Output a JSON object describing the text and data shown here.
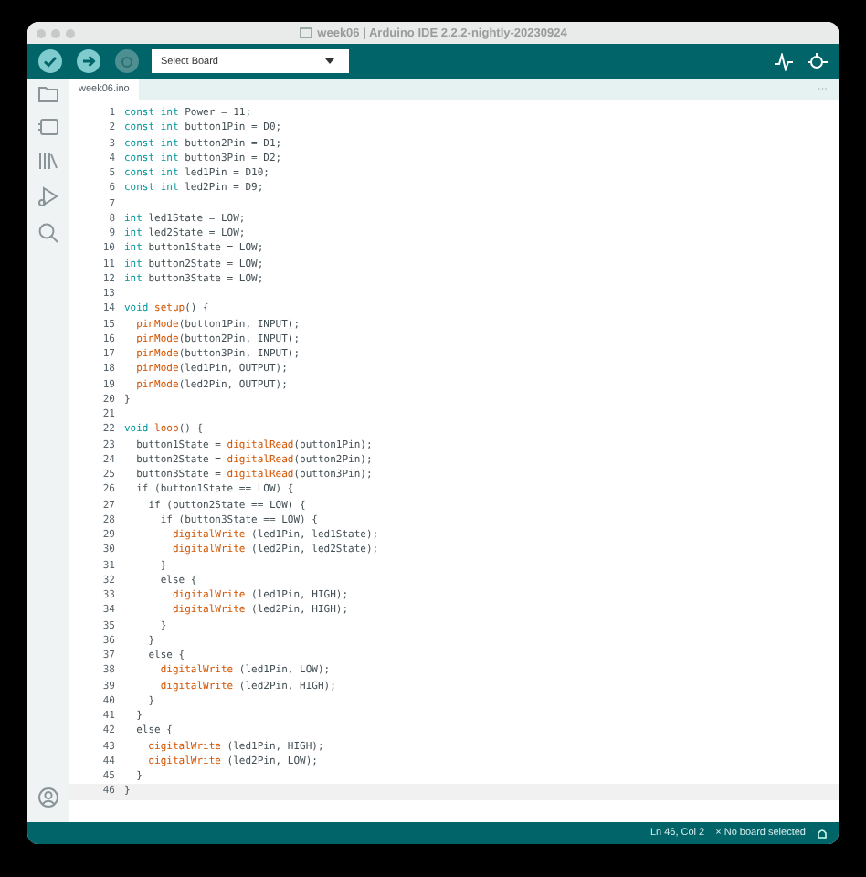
{
  "window": {
    "title": "week06 | Arduino IDE 2.2.2-nightly-20230924"
  },
  "toolbar": {
    "board_select": "Select Board"
  },
  "tabs": [
    {
      "label": "week06.ino",
      "selected": true
    }
  ],
  "tab_menu": "···",
  "editor": {
    "lines": [
      {
        "number": "1",
        "current": false,
        "tokens": [
          {
            "kind": "keyword",
            "text": "const int"
          },
          {
            "kind": "plain",
            "text": " Power = 11;"
          }
        ]
      },
      {
        "number": "2",
        "current": false,
        "tokens": [
          {
            "kind": "keyword",
            "text": "const int"
          },
          {
            "kind": "plain",
            "text": " button1Pin = D0;"
          }
        ]
      },
      {
        "number": "3",
        "current": false,
        "tokens": [
          {
            "kind": "keyword",
            "text": "const int"
          },
          {
            "kind": "plain",
            "text": " button2Pin = D1;"
          }
        ]
      },
      {
        "number": "4",
        "current": false,
        "tokens": [
          {
            "kind": "keyword",
            "text": "const int"
          },
          {
            "kind": "plain",
            "text": " button3Pin = D2;"
          }
        ]
      },
      {
        "number": "5",
        "current": false,
        "tokens": [
          {
            "kind": "keyword",
            "text": "const int"
          },
          {
            "kind": "plain",
            "text": " led1Pin = D10;"
          }
        ]
      },
      {
        "number": "6",
        "current": false,
        "tokens": [
          {
            "kind": "keyword",
            "text": "const int"
          },
          {
            "kind": "plain",
            "text": " led2Pin = D9;"
          }
        ]
      },
      {
        "number": "7",
        "current": false
      },
      {
        "number": "8",
        "current": false,
        "tokens": [
          {
            "kind": "keyword",
            "text": "int"
          },
          {
            "kind": "plain",
            "text": " led1State = LOW;"
          }
        ]
      },
      {
        "number": "9",
        "current": false,
        "tokens": [
          {
            "kind": "keyword",
            "text": "int"
          },
          {
            "kind": "plain",
            "text": " led2State = LOW;"
          }
        ]
      },
      {
        "number": "10",
        "current": false,
        "tokens": [
          {
            "kind": "keyword",
            "text": "int"
          },
          {
            "kind": "plain",
            "text": " button1State = LOW;"
          }
        ]
      },
      {
        "number": "11",
        "current": false,
        "tokens": [
          {
            "kind": "keyword",
            "text": "int"
          },
          {
            "kind": "plain",
            "text": " button2State = LOW;"
          }
        ]
      },
      {
        "number": "12",
        "current": false,
        "tokens": [
          {
            "kind": "keyword",
            "text": "int"
          },
          {
            "kind": "plain",
            "text": " button3State = LOW;"
          }
        ]
      },
      {
        "number": "13",
        "current": false
      },
      {
        "number": "14",
        "current": false,
        "tokens": [
          {
            "kind": "keyword",
            "text": "void"
          },
          {
            "kind": "function",
            "text": " setup"
          },
          {
            "kind": "plain",
            "text": "() {"
          }
        ]
      },
      {
        "number": "15",
        "current": false,
        "tokens": [
          {
            "kind": "function",
            "text": "  pinMode"
          },
          {
            "kind": "plain",
            "text": "(button1Pin, INPUT);"
          }
        ]
      },
      {
        "number": "16",
        "current": false,
        "tokens": [
          {
            "kind": "function",
            "text": "  pinMode"
          },
          {
            "kind": "plain",
            "text": "(button2Pin, INPUT);"
          }
        ]
      },
      {
        "number": "17",
        "current": false,
        "tokens": [
          {
            "kind": "function",
            "text": "  pinMode"
          },
          {
            "kind": "plain",
            "text": "(button3Pin, INPUT);"
          }
        ]
      },
      {
        "number": "18",
        "current": false,
        "tokens": [
          {
            "kind": "function",
            "text": "  pinMode"
          },
          {
            "kind": "plain",
            "text": "(led1Pin, OUTPUT);"
          }
        ]
      },
      {
        "number": "19",
        "current": false,
        "tokens": [
          {
            "kind": "function",
            "text": "  pinMode"
          },
          {
            "kind": "plain",
            "text": "(led2Pin, OUTPUT);"
          }
        ]
      },
      {
        "number": "20",
        "current": false,
        "tokens": [
          {
            "kind": "plain",
            "text": "}"
          }
        ]
      },
      {
        "number": "21",
        "current": false
      },
      {
        "number": "22",
        "current": false,
        "tokens": [
          {
            "kind": "keyword",
            "text": "void"
          },
          {
            "kind": "function",
            "text": " loop"
          },
          {
            "kind": "plain",
            "text": "() {"
          }
        ]
      },
      {
        "number": "23",
        "current": false,
        "tokens": [
          {
            "kind": "plain",
            "text": "  button1State = "
          },
          {
            "kind": "function",
            "text": "digitalRead"
          },
          {
            "kind": "plain",
            "text": "(button1Pin);"
          }
        ]
      },
      {
        "number": "24",
        "current": false,
        "tokens": [
          {
            "kind": "plain",
            "text": "  button2State = "
          },
          {
            "kind": "function",
            "text": "digitalRead"
          },
          {
            "kind": "plain",
            "text": "(button2Pin);"
          }
        ]
      },
      {
        "number": "25",
        "current": false,
        "tokens": [
          {
            "kind": "plain",
            "text": "  button3State = "
          },
          {
            "kind": "function",
            "text": "digitalRead"
          },
          {
            "kind": "plain",
            "text": "(button3Pin);"
          }
        ]
      },
      {
        "number": "26",
        "current": false,
        "tokens": [
          {
            "kind": "plain",
            "text": "  if (button1State == LOW) {"
          }
        ]
      },
      {
        "number": "27",
        "current": false,
        "tokens": [
          {
            "kind": "plain",
            "text": "    if (button2State == LOW) {"
          }
        ]
      },
      {
        "number": "28",
        "current": false,
        "tokens": [
          {
            "kind": "plain",
            "text": "      if (button3State == LOW) {"
          }
        ]
      },
      {
        "number": "29",
        "current": false,
        "tokens": [
          {
            "kind": "function",
            "text": "        digitalWrite"
          },
          {
            "kind": "plain",
            "text": " (led1Pin, led1State);"
          }
        ]
      },
      {
        "number": "30",
        "current": false,
        "tokens": [
          {
            "kind": "function",
            "text": "        digitalWrite"
          },
          {
            "kind": "plain",
            "text": " (led2Pin, led2State);"
          }
        ]
      },
      {
        "number": "31",
        "current": false,
        "tokens": [
          {
            "kind": "plain",
            "text": "      }"
          }
        ]
      },
      {
        "number": "32",
        "current": false,
        "tokens": [
          {
            "kind": "plain",
            "text": "      else {"
          }
        ]
      },
      {
        "number": "33",
        "current": false,
        "tokens": [
          {
            "kind": "function",
            "text": "        digitalWrite"
          },
          {
            "kind": "plain",
            "text": " (led1Pin, HIGH);"
          }
        ]
      },
      {
        "number": "34",
        "current": false,
        "tokens": [
          {
            "kind": "function",
            "text": "        digitalWrite"
          },
          {
            "kind": "plain",
            "text": " (led2Pin, HIGH);"
          }
        ]
      },
      {
        "number": "35",
        "current": false,
        "tokens": [
          {
            "kind": "plain",
            "text": "      }"
          }
        ]
      },
      {
        "number": "36",
        "current": false,
        "tokens": [
          {
            "kind": "plain",
            "text": "    }"
          }
        ]
      },
      {
        "number": "37",
        "current": false,
        "tokens": [
          {
            "kind": "plain",
            "text": "    else {"
          }
        ]
      },
      {
        "number": "38",
        "current": false,
        "tokens": [
          {
            "kind": "function",
            "text": "      digitalWrite"
          },
          {
            "kind": "plain",
            "text": " (led1Pin, LOW);"
          }
        ]
      },
      {
        "number": "39",
        "current": false,
        "tokens": [
          {
            "kind": "function",
            "text": "      digitalWrite"
          },
          {
            "kind": "plain",
            "text": " (led2Pin, HIGH);"
          }
        ]
      },
      {
        "number": "40",
        "current": false,
        "tokens": [
          {
            "kind": "plain",
            "text": "    }"
          }
        ]
      },
      {
        "number": "41",
        "current": false,
        "tokens": [
          {
            "kind": "plain",
            "text": "  }"
          }
        ]
      },
      {
        "number": "42",
        "current": false,
        "tokens": [
          {
            "kind": "plain",
            "text": "  else {"
          }
        ]
      },
      {
        "number": "43",
        "current": false,
        "tokens": [
          {
            "kind": "function",
            "text": "    digitalWrite"
          },
          {
            "kind": "plain",
            "text": " (led1Pin, HIGH);"
          }
        ]
      },
      {
        "number": "44",
        "current": false,
        "tokens": [
          {
            "kind": "function",
            "text": "    digitalWrite"
          },
          {
            "kind": "plain",
            "text": " (led2Pin, LOW);"
          }
        ]
      },
      {
        "number": "45",
        "current": false,
        "tokens": [
          {
            "kind": "plain",
            "text": "  }"
          }
        ]
      },
      {
        "number": "46",
        "current": true,
        "tokens": [
          {
            "kind": "plain",
            "text": "}"
          }
        ]
      }
    ]
  },
  "status_bar": {
    "position": "Ln 46, Col 2",
    "board": "× No board selected"
  }
}
